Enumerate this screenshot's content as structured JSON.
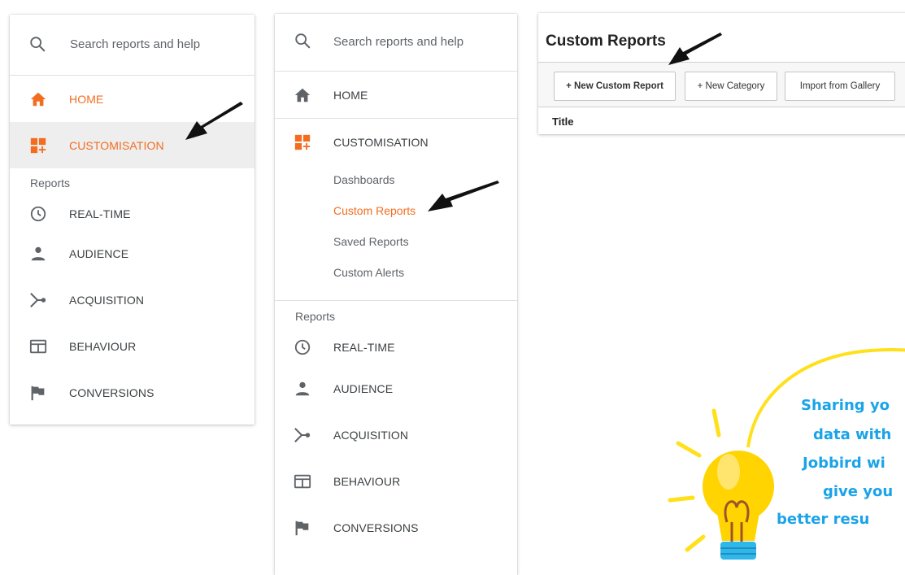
{
  "panel1": {
    "search_label": "Search reports and help",
    "home": "HOME",
    "customisation": "CUSTOMISATION",
    "reports_label": "Reports",
    "items": [
      "REAL-TIME",
      "AUDIENCE",
      "ACQUISITION",
      "BEHAVIOUR",
      "CONVERSIONS"
    ]
  },
  "panel2": {
    "search_label": "Search reports and help",
    "home": "HOME",
    "customisation": "CUSTOMISATION",
    "sub_items": [
      "Dashboards",
      "Custom Reports",
      "Saved Reports",
      "Custom Alerts"
    ],
    "reports_label": "Reports",
    "items": [
      "REAL-TIME",
      "AUDIENCE",
      "ACQUISITION",
      "BEHAVIOUR",
      "CONVERSIONS"
    ]
  },
  "panel3": {
    "title": "Custom Reports",
    "buttons": [
      "+ New Custom Report",
      "+ New Category",
      "Import from Gallery"
    ],
    "column_title": "Title"
  },
  "callout": {
    "lines": [
      "Sharing yo",
      "data with",
      "Jobbird wi",
      "give you",
      "better resu"
    ]
  },
  "colors": {
    "accent_orange": "#f36d21",
    "text_grey": "#3c4043",
    "callout_blue": "#1aa3e8",
    "bulb_yellow": "#ffe01b"
  }
}
